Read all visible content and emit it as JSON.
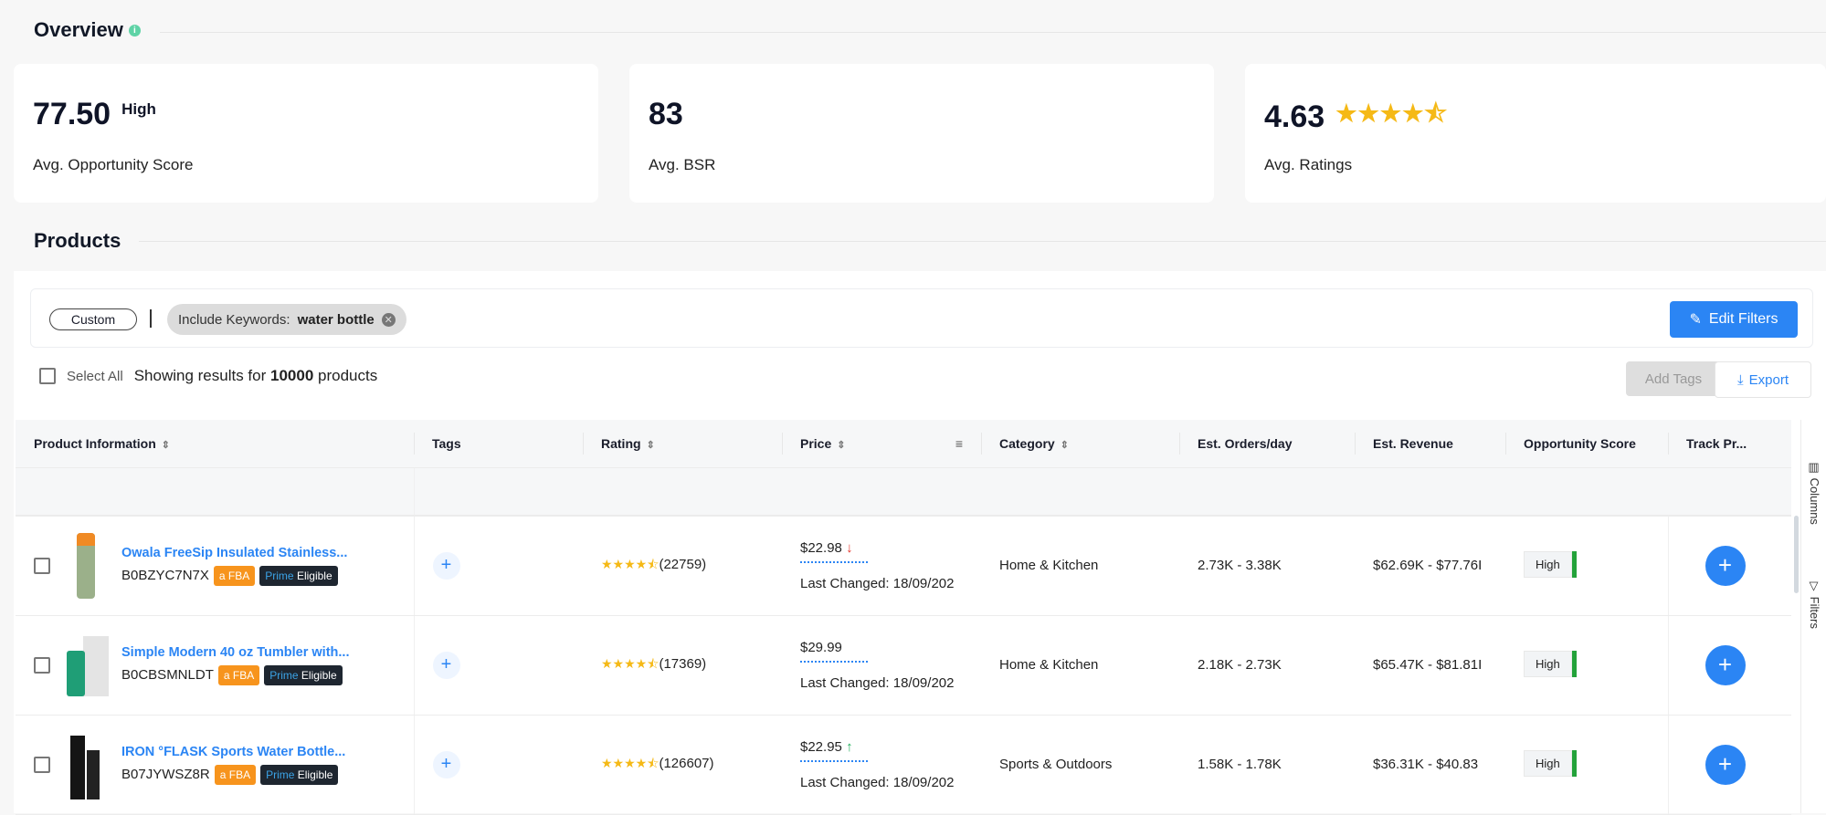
{
  "overview": {
    "title": "Overview",
    "info_icon": "info-icon",
    "cards": [
      {
        "value": "77.50",
        "badge": "High",
        "label": "Avg. Opportunity Score"
      },
      {
        "value": "83",
        "label": "Avg. BSR"
      },
      {
        "value": "4.63",
        "stars": "★★★★⯪",
        "label": "Avg. Ratings"
      }
    ]
  },
  "products": {
    "title": "Products",
    "filters": {
      "preset": "Custom",
      "chip_label": "Include Keywords:",
      "chip_value": "water bottle",
      "edit_label": "Edit Filters"
    },
    "select_all": "Select All",
    "results_prefix": "Showing results for",
    "results_count": "10000",
    "results_suffix": "products",
    "add_tags": "Add Tags",
    "export": "Export",
    "columns": [
      "Product Information",
      "Tags",
      "Rating",
      "Price",
      "Category",
      "Est. Orders/day",
      "Est. Revenue",
      "Opportunity Score",
      "Track Pr..."
    ],
    "rows": [
      {
        "title": "Owala FreeSip Insulated Stainless...",
        "asin": "B0BZYC7N7X",
        "fba": "FBA",
        "prime": "Prime",
        "eligible": "Eligible",
        "stars": "★★★★⯪",
        "reviews": "(22759)",
        "price": "$22.98",
        "trend": "↓",
        "trend_dir": "down",
        "changed": "Last Changed: 18/09/202",
        "category": "Home & Kitchen",
        "orders": "2.73K - 3.38K",
        "revenue": "$62.69K - $77.76I",
        "opp": "High"
      },
      {
        "title": "Simple Modern 40 oz Tumbler with...",
        "asin": "B0CBSMNLDT",
        "fba": "FBA",
        "prime": "Prime",
        "eligible": "Eligible",
        "stars": "★★★★⯪",
        "reviews": "(17369)",
        "price": "$29.99",
        "trend": "",
        "trend_dir": "none",
        "changed": "Last Changed: 18/09/202",
        "category": "Home & Kitchen",
        "orders": "2.18K - 2.73K",
        "revenue": "$65.47K - $81.81I",
        "opp": "High"
      },
      {
        "title": "IRON °FLASK Sports Water Bottle...",
        "asin": "B07JYWSZ8R",
        "fba": "FBA",
        "prime": "Prime",
        "eligible": "Eligible",
        "stars": "★★★★⯪",
        "reviews": "(126607)",
        "price": "$22.95",
        "trend": "↑",
        "trend_dir": "up",
        "changed": "Last Changed: 18/09/202",
        "category": "Sports & Outdoors",
        "orders": "1.58K - 1.78K",
        "revenue": "$36.31K - $40.83",
        "opp": "High"
      }
    ]
  },
  "side": {
    "columns": "Columns",
    "filters": "Filters"
  },
  "colors": {
    "accent": "#2b85f4",
    "fba": "#f7941d",
    "prime_bg": "#1e2630",
    "high": "#23a23a",
    "star": "#f5b916"
  }
}
